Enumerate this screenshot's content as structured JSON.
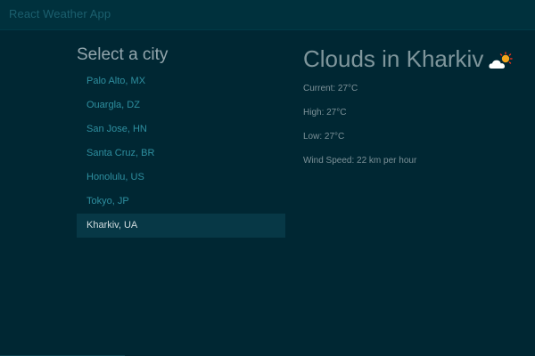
{
  "navbar": {
    "brand": "React Weather App"
  },
  "cities": {
    "heading": "Select a city",
    "items": [
      {
        "label": "Palo Alto, MX"
      },
      {
        "label": "Ouargla, DZ"
      },
      {
        "label": "San Jose, HN"
      },
      {
        "label": "Santa Cruz, BR"
      },
      {
        "label": "Honolulu, US"
      },
      {
        "label": "Tokyo, JP"
      },
      {
        "label": "Kharkiv, UA"
      }
    ],
    "selected": "Kharkiv, UA"
  },
  "weather": {
    "title": "Clouds in Kharkiv",
    "icon": "cloud-sun-icon",
    "current": "Current: 27°C",
    "high": "High: 27°C",
    "low": "Low: 27°C",
    "wind": "Wind Speed: 22 km per hour"
  },
  "colors": {
    "background": "#002733",
    "navbar": "#00313d",
    "link": "#2e8fa0",
    "active_item_bg": "#073846"
  }
}
